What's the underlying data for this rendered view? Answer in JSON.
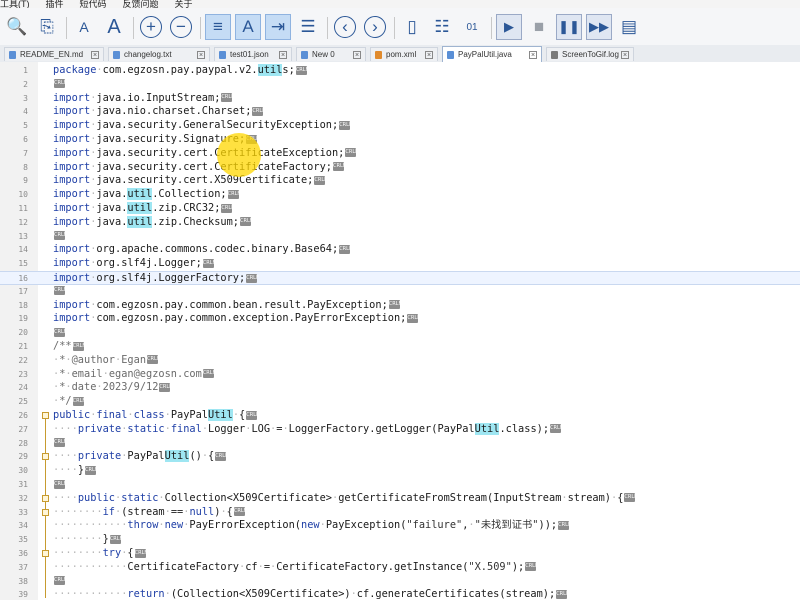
{
  "menubar": {
    "items": [
      "工具(T)",
      "插件",
      "短代码",
      "反馈问题",
      "关于"
    ]
  },
  "toolbar": {
    "buttons": [
      {
        "name": "find-icon",
        "glyph": "🔍"
      },
      {
        "name": "find-in-files-icon",
        "glyph": "⎘"
      },
      {
        "name": "sep"
      },
      {
        "name": "font-decrease-icon",
        "glyph": "A"
      },
      {
        "name": "font-increase-icon",
        "glyph": "A"
      },
      {
        "name": "sep"
      },
      {
        "name": "zoom-in-icon",
        "glyph": "+"
      },
      {
        "name": "zoom-out-icon",
        "glyph": "−"
      },
      {
        "name": "sep"
      },
      {
        "name": "word-wrap-icon",
        "glyph": "≡"
      },
      {
        "name": "show-all-chars-icon",
        "glyph": "A"
      },
      {
        "name": "indent-guide-icon",
        "glyph": "⇥"
      },
      {
        "name": "document-map-icon",
        "glyph": "☰"
      },
      {
        "name": "sep"
      },
      {
        "name": "nav-back-icon",
        "glyph": "‹"
      },
      {
        "name": "nav-forward-icon",
        "glyph": "›"
      },
      {
        "name": "sep"
      },
      {
        "name": "split-view-icon",
        "glyph": "▯"
      },
      {
        "name": "function-list-icon",
        "glyph": "☷"
      },
      {
        "name": "binary-icon",
        "glyph": "01"
      },
      {
        "name": "sep"
      },
      {
        "name": "record-macro-icon",
        "glyph": "▶"
      },
      {
        "name": "stop-macro-icon",
        "glyph": "■"
      },
      {
        "name": "pause-macro-icon",
        "glyph": "❚❚"
      },
      {
        "name": "playback-macro-icon",
        "glyph": "▶▶"
      },
      {
        "name": "save-macro-icon",
        "glyph": "▤"
      }
    ]
  },
  "tabs": [
    {
      "label": "README_EN.md",
      "type": "doc"
    },
    {
      "label": "changelog.txt",
      "type": "doc"
    },
    {
      "label": "test01.json",
      "type": "doc"
    },
    {
      "label": "New 0",
      "type": "doc"
    },
    {
      "label": "pom.xml",
      "type": "xml"
    },
    {
      "label": "PayPalUtil.java",
      "type": "doc",
      "active": true
    },
    {
      "label": "ScreenToGif.log",
      "type": "log"
    }
  ],
  "code": [
    {
      "n": "1",
      "html": "<span class=\"kw\">package</span><span class=\"ws\">·</span>com.egzosn.pay.paypal.v2.<span class=\"ht\">util</span>s;"
    },
    {
      "n": "2",
      "html": ""
    },
    {
      "n": "3",
      "html": "<span class=\"kw\">import</span><span class=\"ws\">·</span>java.io.InputStream;"
    },
    {
      "n": "4",
      "html": "<span class=\"kw\">import</span><span class=\"ws\">·</span>java.nio.charset.Charset;"
    },
    {
      "n": "5",
      "html": "<span class=\"kw\">import</span><span class=\"ws\">·</span>java.security.GeneralSecurityException;"
    },
    {
      "n": "6",
      "html": "<span class=\"kw\">import</span><span class=\"ws\">·</span>java.security.Signature;"
    },
    {
      "n": "7",
      "html": "<span class=\"kw\">import</span><span class=\"ws\">·</span>java.security.cert.CertificateException;"
    },
    {
      "n": "8",
      "html": "<span class=\"kw\">import</span><span class=\"ws\">·</span>java.security.cert.CertificateFactory;"
    },
    {
      "n": "9",
      "html": "<span class=\"kw\">import</span><span class=\"ws\">·</span>java.security.cert.X509Certificate;"
    },
    {
      "n": "10",
      "html": "<span class=\"kw\">import</span><span class=\"ws\">·</span>java.<span class=\"ht\">util</span>.Collection;"
    },
    {
      "n": "11",
      "html": "<span class=\"kw\">import</span><span class=\"ws\">·</span>java.<span class=\"ht\">util</span>.zip.CRC32;"
    },
    {
      "n": "12",
      "html": "<span class=\"kw\">import</span><span class=\"ws\">·</span>java.<span class=\"ht\">util</span>.zip.Checksum;"
    },
    {
      "n": "13",
      "html": ""
    },
    {
      "n": "14",
      "html": "<span class=\"kw\">import</span><span class=\"ws\">·</span>org.apache.commons.codec.binary.Base64;"
    },
    {
      "n": "15",
      "html": "<span class=\"kw\">import</span><span class=\"ws\">·</span>org.slf4j.Logger;"
    },
    {
      "n": "16",
      "html": "<span class=\"kw\">import</span><span class=\"ws\">·</span>org.slf4j.LoggerFactory;",
      "hl": true
    },
    {
      "n": "17",
      "html": ""
    },
    {
      "n": "18",
      "html": "<span class=\"kw\">import</span><span class=\"ws\">·</span>com.egzosn.pay.common.bean.result.PayException;"
    },
    {
      "n": "19",
      "html": "<span class=\"kw\">import</span><span class=\"ws\">·</span>com.egzosn.pay.common.exception.PayErrorException;"
    },
    {
      "n": "20",
      "html": ""
    },
    {
      "n": "21",
      "html": "<span class=\"cm\">/**</span>"
    },
    {
      "n": "22",
      "html": "<span class=\"cm\"><span class=\"ws\">·</span>*<span class=\"ws\">·</span>@author<span class=\"ws\">·</span>Egan</span>"
    },
    {
      "n": "23",
      "html": "<span class=\"cm\"><span class=\"ws\">·</span>*<span class=\"ws\">·</span>email<span class=\"ws\">·</span>egan@egzosn.com</span>"
    },
    {
      "n": "24",
      "html": "<span class=\"cm\"><span class=\"ws\">·</span>*<span class=\"ws\">·</span>date<span class=\"ws\">·</span>2023/9/12</span>"
    },
    {
      "n": "25",
      "html": "<span class=\"cm\"><span class=\"ws\">·</span>*/</span>"
    },
    {
      "n": "26",
      "html": "<span class=\"kw\">public</span><span class=\"ws\">·</span><span class=\"kw\">final</span><span class=\"ws\">·</span><span class=\"kw\">class</span><span class=\"ws\">·</span>PayPal<span class=\"ht\">Util</span><span class=\"ws\">·</span>{"
    },
    {
      "n": "27",
      "html": "<span class=\"ws\">····</span><span class=\"kw\">private</span><span class=\"ws\">·</span><span class=\"kw\">static</span><span class=\"ws\">·</span><span class=\"kw\">final</span><span class=\"ws\">·</span>Logger<span class=\"ws\">·</span>LOG<span class=\"ws\">·</span>=<span class=\"ws\">·</span>LoggerFactory.getLogger(PayPal<span class=\"ht\">Util</span>.class);"
    },
    {
      "n": "28",
      "html": ""
    },
    {
      "n": "29",
      "html": "<span class=\"ws\">····</span><span class=\"kw\">private</span><span class=\"ws\">·</span>PayPal<span class=\"ht\">Util</span>()<span class=\"ws\">·</span>{"
    },
    {
      "n": "30",
      "html": "<span class=\"ws\">····</span>}"
    },
    {
      "n": "31",
      "html": ""
    },
    {
      "n": "32",
      "html": "<span class=\"ws\">····</span><span class=\"kw\">public</span><span class=\"ws\">·</span><span class=\"kw\">static</span><span class=\"ws\">·</span>Collection&lt;X509Certificate&gt;<span class=\"ws\">·</span>getCertificateFromStream(InputStream<span class=\"ws\">·</span>stream)<span class=\"ws\">·</span>{"
    },
    {
      "n": "33",
      "html": "<span class=\"ws\">········</span><span class=\"kw\">if</span><span class=\"ws\">·</span>(stream<span class=\"ws\">·</span>==<span class=\"ws\">·</span><span class=\"kw\">null</span>)<span class=\"ws\">·</span>{"
    },
    {
      "n": "34",
      "html": "<span class=\"ws\">············</span><span class=\"kw\">throw</span><span class=\"ws\">·</span><span class=\"kw\">new</span><span class=\"ws\">·</span>PayErrorException(<span class=\"kw\">new</span><span class=\"ws\">·</span>PayException(<span class=\"st\">\"failure\"</span>,<span class=\"ws\">·</span><span class=\"st\">\"未找到证书\"</span>));"
    },
    {
      "n": "35",
      "html": "<span class=\"ws\">········</span>}"
    },
    {
      "n": "36",
      "html": "<span class=\"ws\">········</span><span class=\"kw\">try</span><span class=\"ws\">·</span>{"
    },
    {
      "n": "37",
      "html": "<span class=\"ws\">············</span>CertificateFactory<span class=\"ws\">·</span>cf<span class=\"ws\">·</span>=<span class=\"ws\">·</span>CertificateFactory.getInstance(<span class=\"st\">\"X.509\"</span>);"
    },
    {
      "n": "38",
      "html": ""
    },
    {
      "n": "39",
      "html": "<span class=\"ws\">············</span><span class=\"kw\">return</span><span class=\"ws\">·</span>(Collection&lt;X509Certificate&gt;)<span class=\"ws\">·</span>cf.generateCertificates(stream);"
    }
  ],
  "eol_label": "CRLF"
}
